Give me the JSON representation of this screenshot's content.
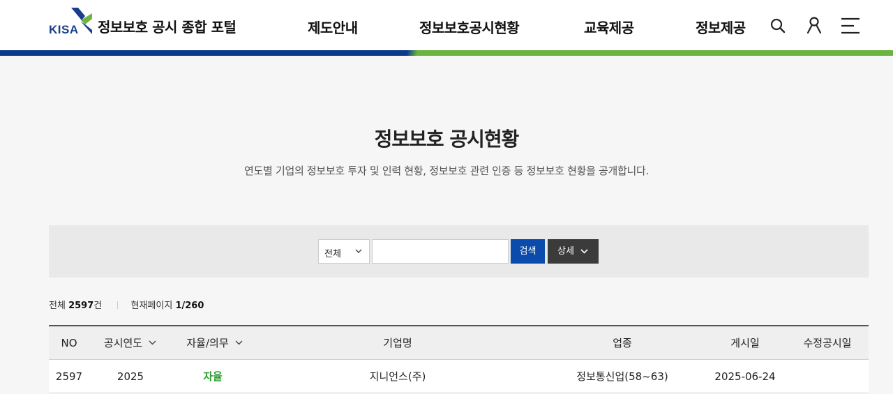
{
  "header": {
    "logo_mark_text": "KISA",
    "portal_title": "정보보호 공시 종합 포털",
    "nav": [
      "제도안내",
      "정보보호공시현황",
      "교육제공",
      "정보제공"
    ],
    "icons": [
      "search-icon",
      "user-icon",
      "menu-icon"
    ],
    "colors": {
      "blue": "#0a3a8a",
      "green": "#6cb33f"
    }
  },
  "page": {
    "title": "정보보호 공시현황",
    "description": "연도별 기업의 정보보호 투자 및 인력 현황, 정보보호 관련 인증 등 정보보호 현황을 공개합니다."
  },
  "search": {
    "select_value": "전체",
    "input_value": "",
    "search_label": "검색",
    "detail_label": "상세"
  },
  "summary": {
    "total_label": "전체",
    "total_count": "2597",
    "total_unit": "건",
    "page_label": "현재페이지",
    "page_value": "1/260"
  },
  "table": {
    "columns": [
      "NO",
      "공시연도",
      "자율/의무",
      "기업명",
      "업종",
      "게시일",
      "수정공시일"
    ],
    "rows": [
      {
        "no": "2597",
        "year": "2025",
        "type": "자율",
        "company": "지니언스(주)",
        "industry": "정보통신업(58~63)",
        "posted": "2025-06-24",
        "modified": ""
      }
    ]
  }
}
